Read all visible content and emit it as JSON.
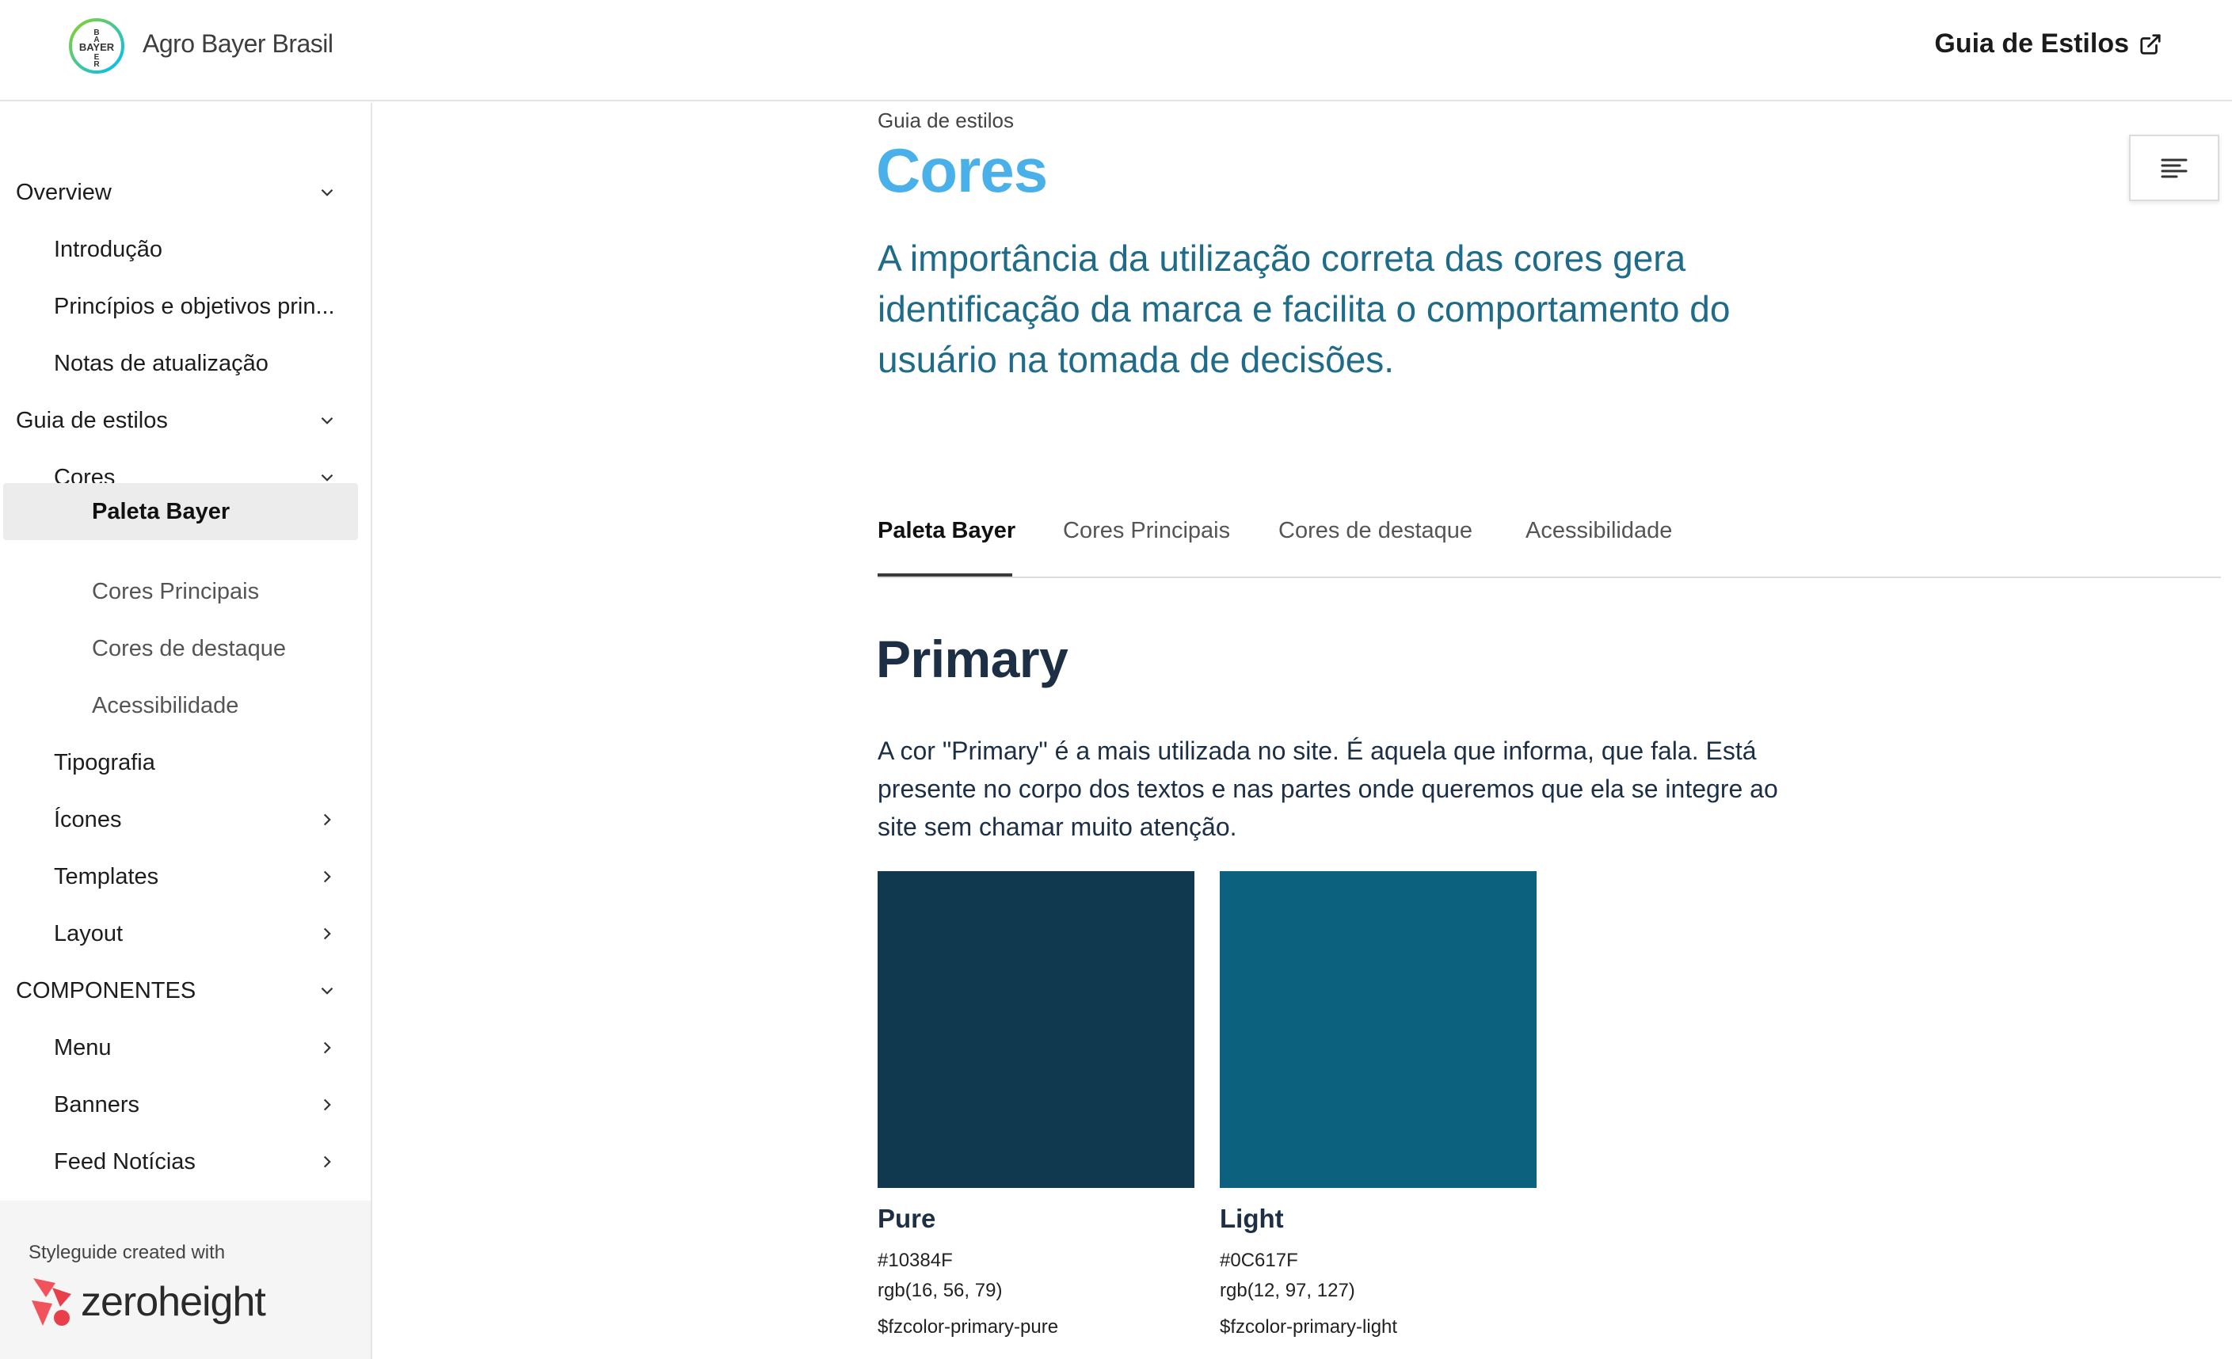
{
  "header": {
    "brand": "Agro Bayer Brasil",
    "logo_text": "BAYER",
    "link_label": "Guia de Estilos",
    "link_icon": "external-link-icon"
  },
  "sidebar": {
    "items": [
      {
        "label": "Overview",
        "level": 0,
        "chevron": "down"
      },
      {
        "label": "Introdução",
        "level": 1
      },
      {
        "label": "Princípios e objetivos prin...",
        "level": 1
      },
      {
        "label": "Notas de atualização",
        "level": 1
      },
      {
        "label": "Guia de estilos",
        "level": 0,
        "chevron": "down"
      },
      {
        "label": "Cores",
        "level": 1,
        "chevron": "down"
      },
      {
        "label": "Paleta Bayer",
        "level": 2,
        "active": true
      },
      {
        "label": "Cores Principais",
        "level": 2
      },
      {
        "label": "Cores de destaque",
        "level": 2
      },
      {
        "label": "Acessibilidade",
        "level": 2
      },
      {
        "label": "Tipografia",
        "level": 1
      },
      {
        "label": "Ícones",
        "level": 1,
        "chevron": "right"
      },
      {
        "label": "Templates",
        "level": 1,
        "chevron": "right"
      },
      {
        "label": "Layout",
        "level": 1,
        "chevron": "right"
      },
      {
        "label": "COMPONENTES",
        "level": 0,
        "chevron": "down"
      },
      {
        "label": "Menu",
        "level": 1,
        "chevron": "right"
      },
      {
        "label": "Banners",
        "level": 1,
        "chevron": "right"
      },
      {
        "label": "Feed Notícias",
        "level": 1,
        "chevron": "right"
      }
    ],
    "footer_text": "Styleguide created with",
    "footer_brand": "zeroheight"
  },
  "main": {
    "breadcrumb": "Guia de estilos",
    "title": "Cores",
    "intro": "A importância da utilização correta das cores gera identificação da marca e facilita o comportamento do usuário na tomada de decisões.",
    "tabs": [
      {
        "label": "Paleta Bayer",
        "active": true
      },
      {
        "label": "Cores Principais"
      },
      {
        "label": "Cores de destaque"
      },
      {
        "label": "Acessibilidade"
      }
    ],
    "section_title": "Primary",
    "section_desc": "A cor \"Primary\" é a mais utilizada no site. É aquela que informa, que fala. Está presente no corpo dos textos e nas partes onde queremos que ela se integre ao site sem chamar muito atenção.",
    "swatches": [
      {
        "name": "Pure",
        "hex": "#10384F",
        "rgb": "rgb(16, 56, 79)",
        "token": "$fzcolor-primary-pure",
        "color": "#10384F"
      },
      {
        "name": "Light",
        "hex": "#0C617F",
        "rgb": "rgb(12, 97, 127)",
        "token": "$fzcolor-primary-light",
        "color": "#0C617F"
      }
    ]
  },
  "colors": {
    "title_accent": "#4ab0ea",
    "intro_text": "#1f6b8a",
    "heading_text": "#1c2f45",
    "active_nav_bg": "#ececec"
  }
}
